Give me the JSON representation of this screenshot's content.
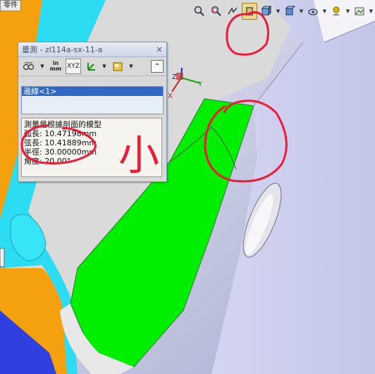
{
  "window": {
    "top_left_tab": "零件"
  },
  "toolbar": {
    "buttons": [
      {
        "name": "zoom-fit",
        "icon": "zoom-to-fit-icon"
      },
      {
        "name": "zoom-area",
        "icon": "zoom-area-icon"
      },
      {
        "name": "previous-view",
        "icon": "previous-view-icon"
      },
      {
        "name": "section-view",
        "icon": "section-view-icon"
      },
      {
        "name": "view-orientation",
        "icon": "view-orientation-icon"
      },
      {
        "name": "display-style",
        "icon": "display-style-icon"
      },
      {
        "name": "hide-show",
        "icon": "hide-show-icon"
      },
      {
        "name": "appearance",
        "icon": "appearance-icon"
      },
      {
        "name": "scene",
        "icon": "scene-icon"
      }
    ]
  },
  "measure_panel": {
    "title": "量測 - zl114a-sx-11-a",
    "close": "×",
    "tools": {
      "units_top": "in",
      "units_bottom": "mm",
      "xyz": "XYZ"
    },
    "selection": [
      "邊線<1>"
    ],
    "results": [
      "測量是根據剖面的模型",
      "弧長:  10.47198mm",
      "弦長:  10.41889mm",
      "半徑:  30.00000mm",
      "角度:  20.00°"
    ]
  },
  "triad": {
    "x_label": "X",
    "y_label": "Y",
    "z_label": "Z"
  },
  "annotations": {
    "handwritten_text": "小"
  },
  "colors": {
    "orange": "#f5a00f",
    "cyan": "#2bdcf2",
    "green": "#00ee00",
    "lavender": "#cfcff0",
    "highlight_red": "#ee1a37",
    "selection_blue": "#3168c6"
  }
}
